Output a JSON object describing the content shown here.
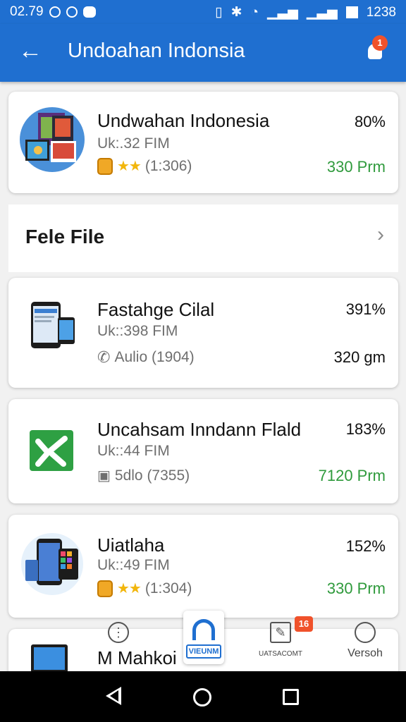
{
  "status_bar": {
    "time": "02.79",
    "clock_right": "1238"
  },
  "app_bar": {
    "back_icon": "arrow-left-icon",
    "title": "Undoahan Indonsia",
    "notification_badge": "1"
  },
  "featured": {
    "name": "Undwahan Indonesia",
    "size": "Uk:.32 FIM",
    "rating_count": "(1:306)",
    "percent": "80%",
    "amount": "330 Prm"
  },
  "section": {
    "label": "Fele File"
  },
  "items": [
    {
      "name": "Fastahge Cilal",
      "size": "Uk::398 FIM",
      "meta": "Aulio (1904)",
      "meta_icon": "phone-icon",
      "percent": "391%",
      "amount": "320 gm",
      "amount_color": "dark"
    },
    {
      "name": "Uncahsam Inndann Flald",
      "size": "Uk::44 FIM",
      "meta": "5dlo (7355)",
      "meta_icon": "save-icon",
      "percent": "183%",
      "amount": "7120 Prm",
      "amount_color": "green"
    },
    {
      "name": "Uiatlaha",
      "size": "Uk::49 FIM",
      "meta": "(1:304)",
      "meta_icon": "medal-icon",
      "percent": "152%",
      "amount": "330 Prm",
      "amount_color": "green"
    },
    {
      "name": "M Mahkoi",
      "size": "",
      "meta": "",
      "percent": "",
      "amount": ""
    }
  ],
  "bottom_nav": {
    "items": [
      {
        "label": "",
        "icon": "more-vertical-icon"
      },
      {
        "label": "VIEUNM",
        "icon": "headphones-icon"
      },
      {
        "label": "UATSACOMT",
        "icon": "edit-icon",
        "badge": "16"
      },
      {
        "label": "Versoh",
        "icon": "user-icon"
      }
    ]
  }
}
